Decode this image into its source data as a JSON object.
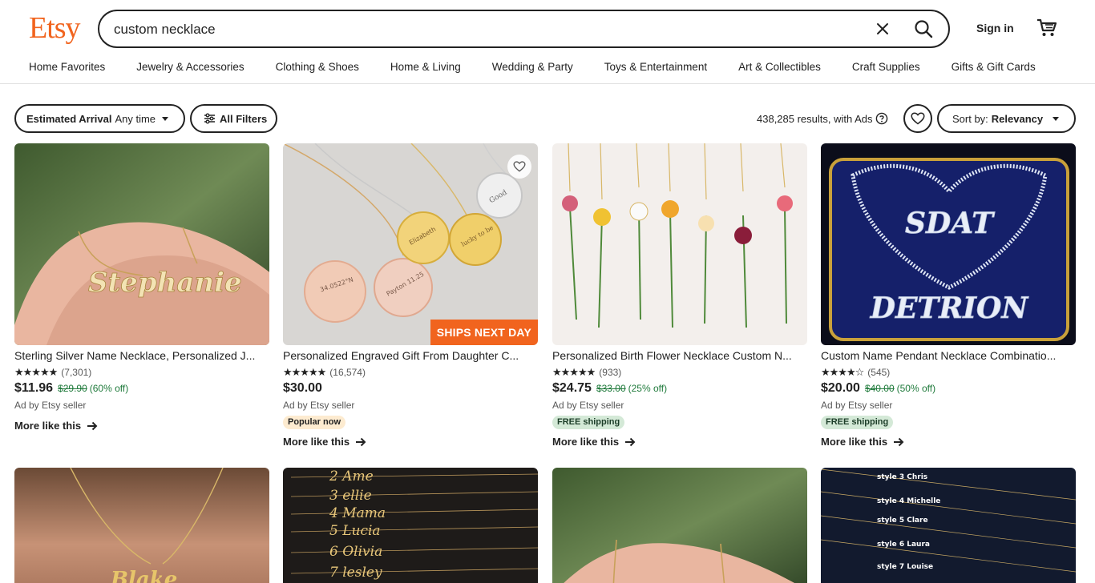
{
  "header": {
    "logo": "Etsy",
    "search_value": "custom necklace",
    "signin": "Sign in",
    "icons": {
      "clear": "close-icon",
      "search": "search-icon",
      "cart": "cart-icon"
    }
  },
  "categories": [
    "Home Favorites",
    "Jewelry & Accessories",
    "Clothing & Shoes",
    "Home & Living",
    "Wedding & Party",
    "Toys & Entertainment",
    "Art & Collectibles",
    "Craft Supplies",
    "Gifts & Gift Cards"
  ],
  "toolbar": {
    "arrival_label": "Estimated Arrival",
    "arrival_value": "Any time",
    "filters_label": "All Filters",
    "results_text": "438,285 results, with Ads",
    "sort_label": "Sort by:",
    "sort_value": "Relevancy"
  },
  "colors": {
    "brand": "#f1641e",
    "sale_green": "#1f7a3b",
    "ship_badge": "#d4e9d7"
  },
  "listings": [
    {
      "title": "Sterling Silver Name Necklace, Personalized J...",
      "stars": "★★★★★",
      "reviews": "(7,301)",
      "price": "$11.96",
      "original_price": "$29.90",
      "discount": "(60% off)",
      "ad_text": "Ad by Etsy seller",
      "more": "More like this",
      "image_text": "Stephanie"
    },
    {
      "title": "Personalized Engraved Gift From Daughter C...",
      "stars": "★★★★★",
      "reviews": "(16,574)",
      "price": "$30.00",
      "ad_text": "Ad by Etsy seller",
      "badge": "Popular now",
      "more": "More like this",
      "image_badge": "SHIPS NEXT DAY"
    },
    {
      "title": "Personalized Birth Flower Necklace Custom N...",
      "stars": "★★★★★",
      "reviews": "(933)",
      "price": "$24.75",
      "original_price": "$33.00",
      "discount": "(25% off)",
      "ad_text": "Ad by Etsy seller",
      "badge": "FREE shipping",
      "more": "More like this"
    },
    {
      "title": "Custom Name Pendant Necklace Combinatio...",
      "stars": "★★★★☆",
      "reviews": "(545)",
      "price": "$20.00",
      "original_price": "$40.00",
      "discount": "(50% off)",
      "ad_text": "Ad by Etsy seller",
      "badge": "FREE shipping",
      "more": "More like this",
      "image_text_1": "SDAT",
      "image_text_2": "DETRION"
    }
  ],
  "row2_images": [
    {
      "text": "Blake"
    },
    {
      "lines": [
        "2 Ame",
        "3 ellie",
        "4 Mama",
        "5 Lucia",
        "6 Olivia",
        "7 lesley"
      ]
    },
    {
      "text": ""
    },
    {
      "lines": [
        "style 3  Chris",
        "style 4  Michelle",
        "style 5  Clare",
        "style 6  Laura",
        "style 7  Louise"
      ]
    }
  ]
}
